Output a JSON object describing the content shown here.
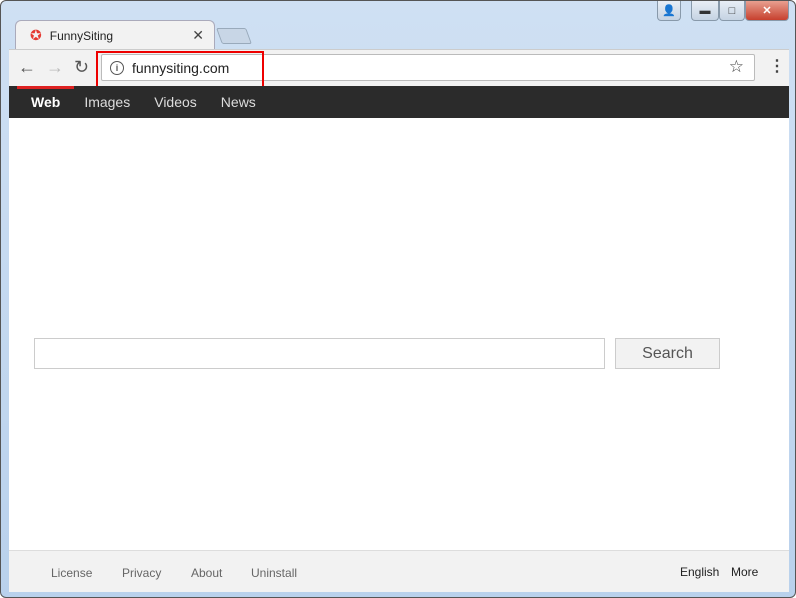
{
  "browser": {
    "tab_title": "FunnySiting",
    "url": "funnysiting.com",
    "icons": {
      "favicon": "red-star-icon",
      "close": "close-icon",
      "back": "back-arrow-icon",
      "forward": "forward-arrow-icon",
      "reload": "reload-icon",
      "info": "info-icon",
      "bookmark": "star-icon",
      "menu": "kebab-menu-icon"
    }
  },
  "nav": {
    "items": [
      {
        "label": "Web",
        "active": true
      },
      {
        "label": "Images"
      },
      {
        "label": "Videos"
      },
      {
        "label": "News"
      }
    ]
  },
  "search": {
    "value": "",
    "button": "Search"
  },
  "footer": {
    "links": [
      "License",
      "Privacy",
      "About",
      "Uninstall"
    ],
    "language": "English",
    "more": "More"
  },
  "colors": {
    "nav_bg": "#2b2b2b",
    "active_indicator": "#dd2222",
    "highlight_box": "#ee0000"
  }
}
